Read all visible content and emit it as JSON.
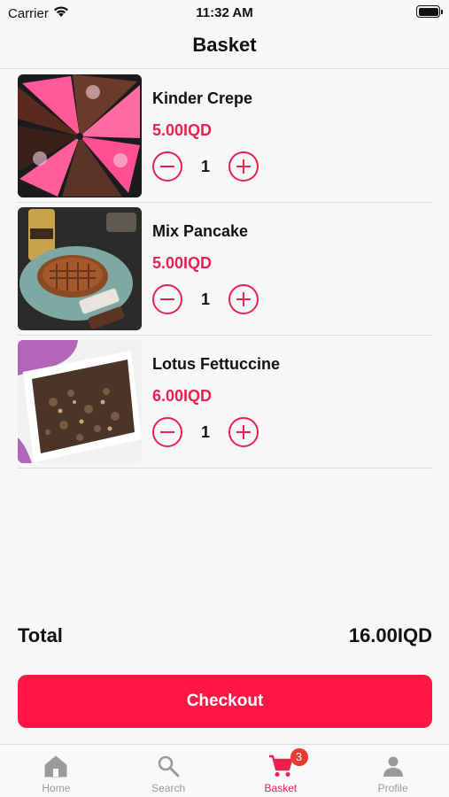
{
  "status_bar": {
    "carrier": "Carrier",
    "time": "11:32 AM"
  },
  "nav": {
    "title": "Basket"
  },
  "items": [
    {
      "name": "Kinder Crepe",
      "price": "5.00IQD",
      "quantity": "1"
    },
    {
      "name": "Mix Pancake",
      "price": "5.00IQD",
      "quantity": "1"
    },
    {
      "name": "Lotus Fettuccine",
      "price": "6.00IQD",
      "quantity": "1"
    }
  ],
  "total": {
    "label": "Total",
    "value": "16.00IQD"
  },
  "checkout": {
    "label": "Checkout"
  },
  "tabs": [
    {
      "label": "Home",
      "icon": "home-icon"
    },
    {
      "label": "Search",
      "icon": "search-icon"
    },
    {
      "label": "Basket",
      "icon": "cart-icon",
      "badge": "3"
    },
    {
      "label": "Profile",
      "icon": "person-icon"
    }
  ],
  "colors": {
    "accent": "#e8214f",
    "checkout": "#fe1745",
    "badge": "#e63b2e",
    "inactive": "#999999"
  }
}
